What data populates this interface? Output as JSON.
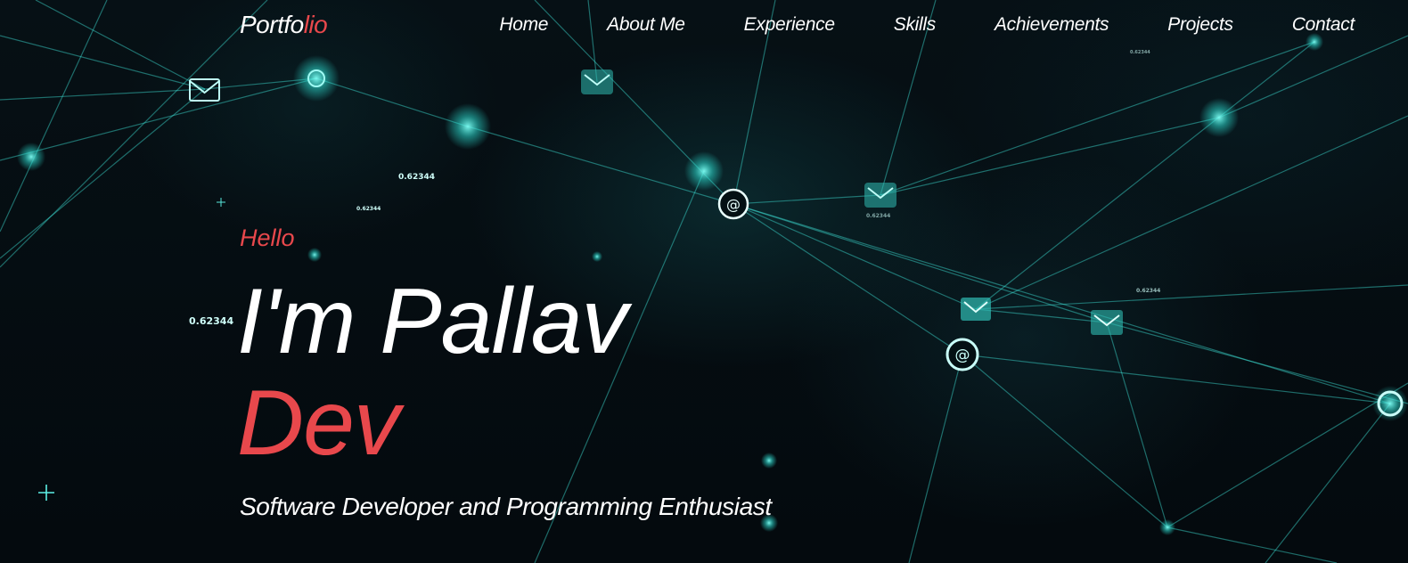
{
  "logo": {
    "main": "Portfo",
    "accent": "lio"
  },
  "nav": {
    "items": [
      "Home",
      "About Me",
      "Experience",
      "Skills",
      "Achievements",
      "Projects",
      "Contact"
    ]
  },
  "hero": {
    "greeting": "Hello",
    "name": "I'm Pallav",
    "role": "Dev",
    "tagline": "Software Developer and Programming Enthusiast",
    "bg_numbers": [
      "0.62344",
      "0.62344",
      "0.62344",
      "0.62344",
      "0.62344",
      "0.62344"
    ]
  },
  "colors": {
    "accent": "#e8484c",
    "text": "#ffffff",
    "network": "#3fe3d8",
    "background": "#050c10"
  },
  "icons": [
    "envelope-icon",
    "at-sign-icon",
    "plus-icon"
  ]
}
